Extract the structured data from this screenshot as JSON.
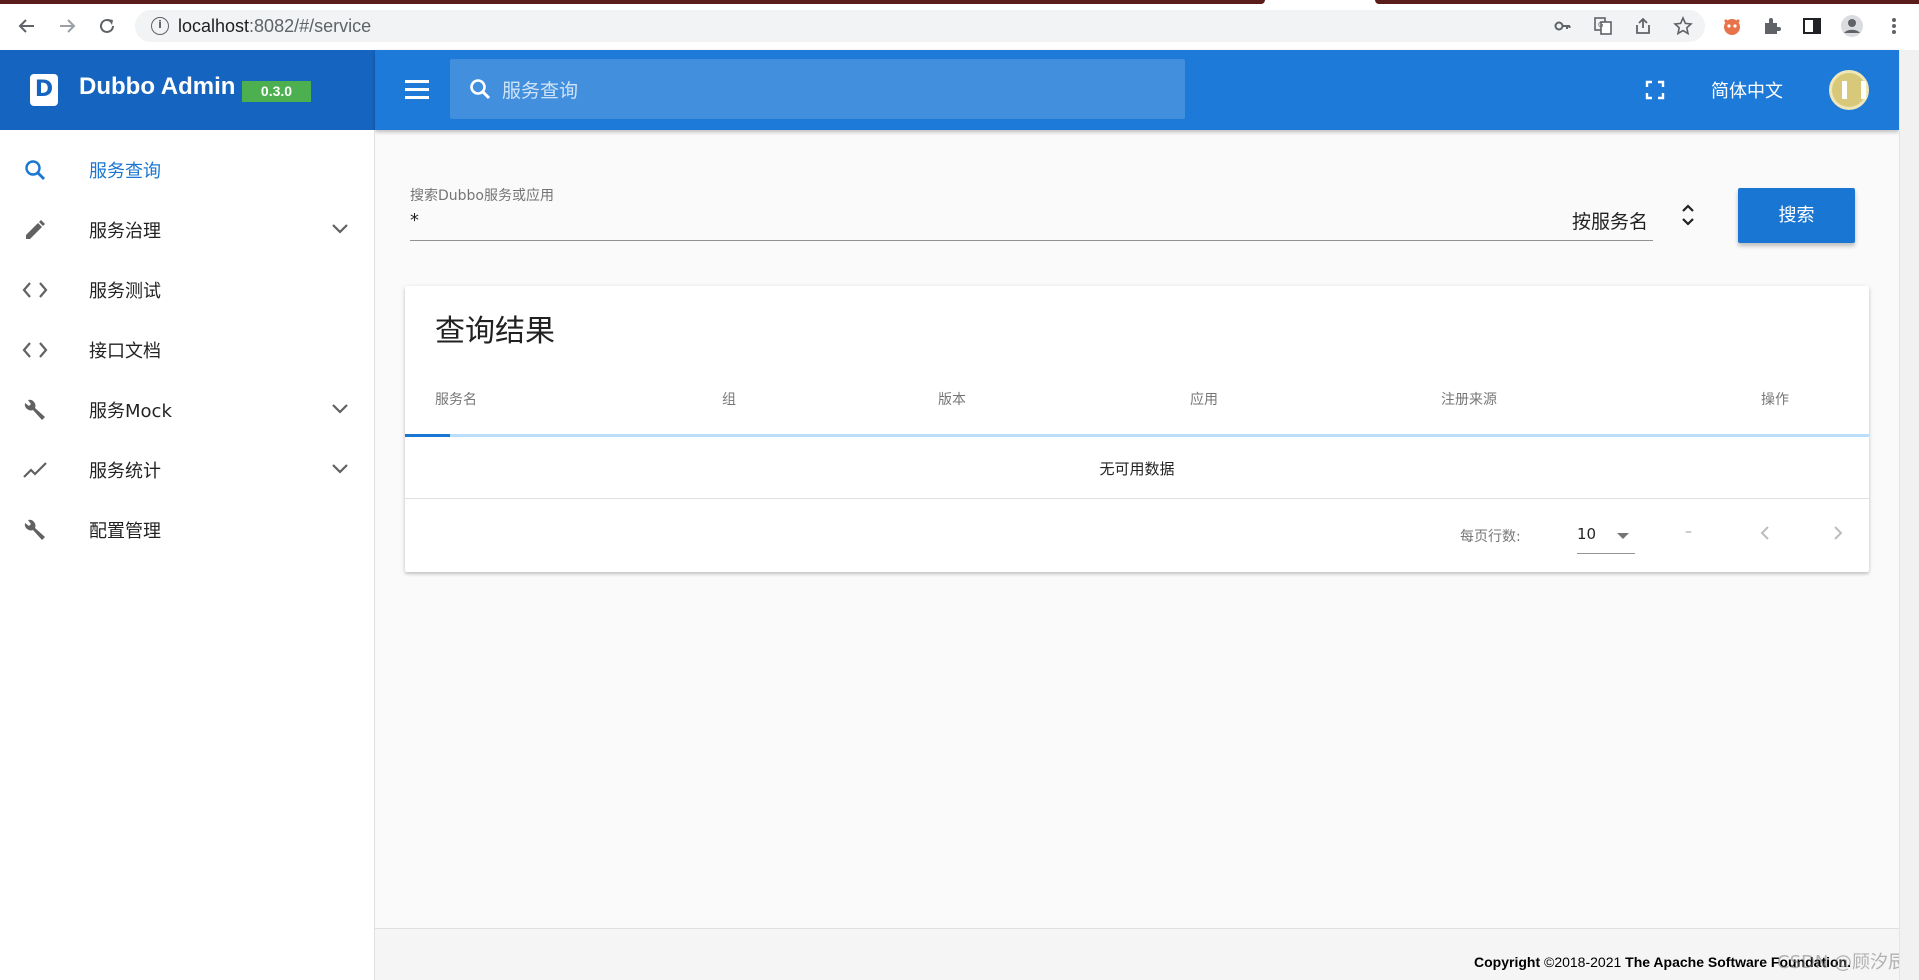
{
  "browser": {
    "url_host": "localhost",
    "url_rest": ":8082/#/service"
  },
  "header": {
    "app_title": "Dubbo Admin",
    "version": "0.3.0",
    "logo_letter": "D",
    "search_placeholder": "服务查询",
    "language": "简体中文"
  },
  "sidebar": {
    "items": [
      {
        "label": "服务查询",
        "icon": "search-icon",
        "active": true
      },
      {
        "label": "服务治理",
        "icon": "pencil-icon",
        "expandable": true
      },
      {
        "label": "服务测试",
        "icon": "code-icon"
      },
      {
        "label": "接口文档",
        "icon": "code-icon"
      },
      {
        "label": "服务Mock",
        "icon": "wrench-icon",
        "expandable": true
      },
      {
        "label": "服务统计",
        "icon": "trending-icon",
        "expandable": true
      },
      {
        "label": "配置管理",
        "icon": "wrench-icon"
      }
    ]
  },
  "search_form": {
    "label": "搜索Dubbo服务或应用",
    "value": "*",
    "select_value": "按服务名",
    "button": "搜索"
  },
  "results": {
    "title": "查询结果",
    "columns": [
      "服务名",
      "组",
      "版本",
      "应用",
      "注册来源",
      "操作"
    ],
    "empty_text": "无可用数据",
    "rows_per_page_label": "每页行数:",
    "rows_per_page": "10",
    "page_range": "–"
  },
  "footer": {
    "copyright_prefix": "Copyright",
    "years": "©2018-2021",
    "org": "The Apache Software Foundation."
  },
  "watermark": "CSDN @顾汐辰",
  "colors": {
    "header_left": "#1565c0",
    "header": "#1e7ad8",
    "accent": "#1976d2",
    "badge": "#4caf50"
  }
}
